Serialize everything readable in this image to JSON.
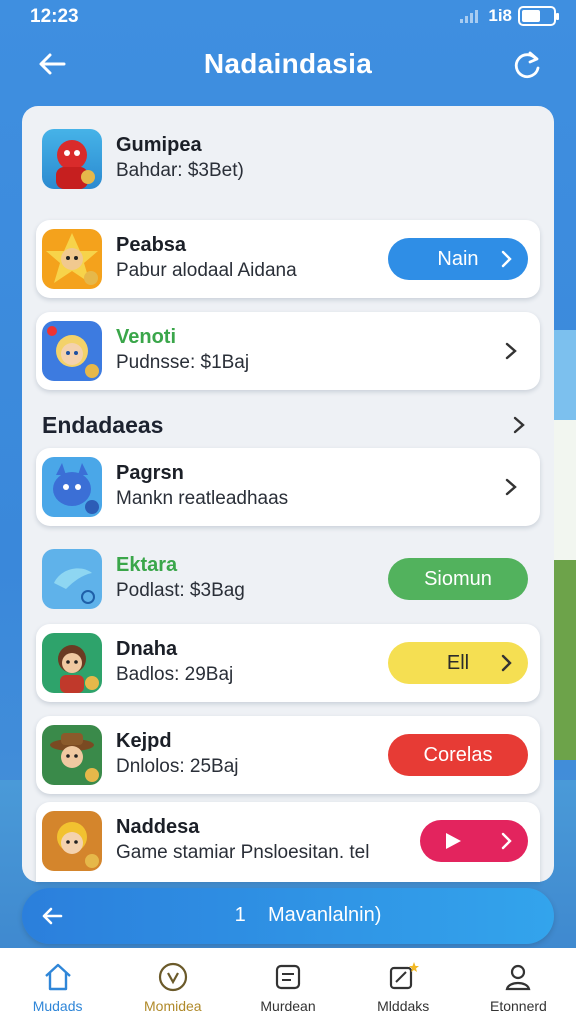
{
  "status_bar": {
    "time": "12:23",
    "network": "1i8"
  },
  "header": {
    "title": "Nadaindasia",
    "back_icon": "arrow-left-icon",
    "refresh_icon": "refresh-icon"
  },
  "list_top": [
    {
      "name": "Gumipea",
      "sub": "Bahdar: $3Bet)",
      "name_color": "dark",
      "action": "none"
    },
    {
      "name": "Peabsa",
      "sub": "Pabur alodaal Aidana",
      "name_color": "dark",
      "action": "pill",
      "action_label": "Nain",
      "action_color": "#2f8ee6"
    },
    {
      "name": "Venoti",
      "sub": "Pudnsse: $1Baj",
      "name_color": "green",
      "action": "chevron"
    }
  ],
  "section": {
    "title": "Endadaeas"
  },
  "list_bottom": [
    {
      "name": "Pagrsn",
      "sub": "Mankn reatleadhaas",
      "name_color": "dark",
      "action": "chevron"
    },
    {
      "name": "Ektara",
      "sub": "Podlast: $3Bag",
      "name_color": "green",
      "action": "pill",
      "action_label": "Siomun",
      "action_color": "#52b25d"
    },
    {
      "name": "Dnaha",
      "sub": "Badlos: 29Baj",
      "name_color": "dark",
      "action": "pill",
      "action_label": "Ell",
      "action_color": "#f5df52"
    },
    {
      "name": "Kejpd",
      "sub": "Dnlolos: 25Baj",
      "name_color": "dark",
      "action": "pill",
      "action_label": "Corelas",
      "action_color": "#e73b35"
    },
    {
      "name": "Naddesa",
      "sub": "Game stamiar Pnsloesitan. tel",
      "name_color": "dark",
      "action": "play",
      "action_color": "#e3245e"
    }
  ],
  "action_bar": {
    "number": "1",
    "label": "Mavanlalnin)"
  },
  "tabs": [
    {
      "label": "Mudads",
      "icon": "home-icon"
    },
    {
      "label": "Momidea",
      "icon": "smile-icon"
    },
    {
      "label": "Murdean",
      "icon": "notes-icon"
    },
    {
      "label": "Mlddaks",
      "icon": "edit-star-icon"
    },
    {
      "label": "Etonnerd",
      "icon": "profile-icon"
    }
  ]
}
